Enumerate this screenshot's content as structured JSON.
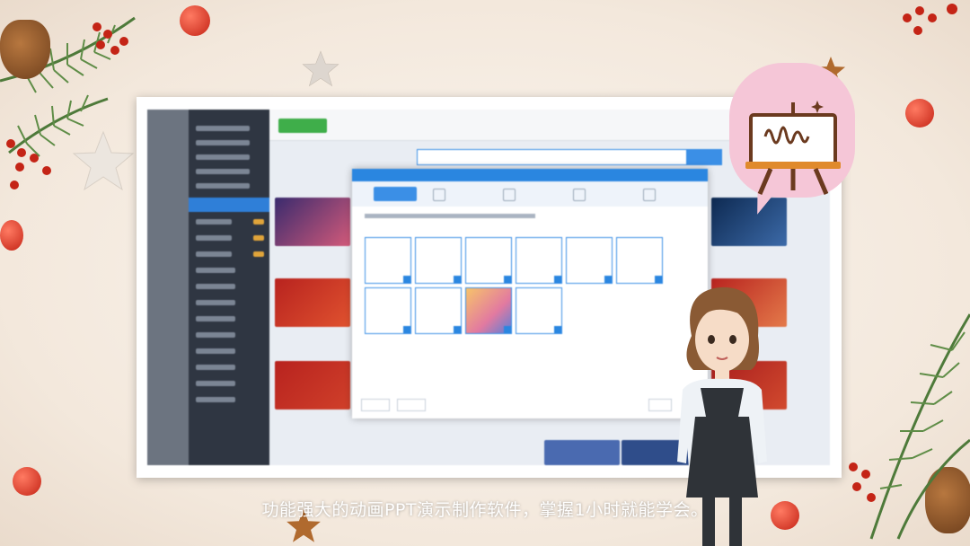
{
  "caption": "功能强大的动画PPT演示制作软件，掌握1小时就能学会。",
  "icons": {
    "easel": "easel-chart-icon",
    "pinecone": "pinecone-icon",
    "star": "star-icon",
    "berry": "berry-icon",
    "ornament": "ornament-ball-icon",
    "avatar": "presenter-avatar"
  },
  "colors": {
    "accent_blue": "#2a86e0",
    "bubble_pink": "#f5c6d7",
    "ornament_red": "#d23a2a",
    "pine_green": "#4e7a3a"
  }
}
